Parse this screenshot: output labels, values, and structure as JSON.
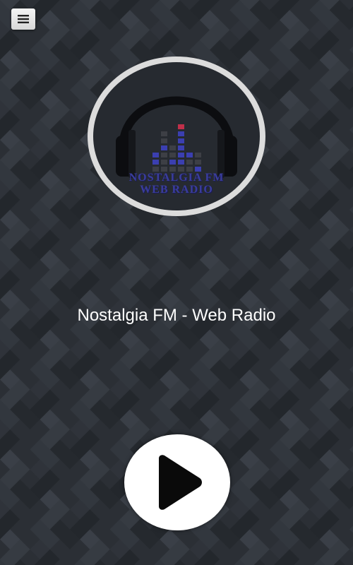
{
  "app": {
    "station_title": "Nostalgia FM - Web Radio"
  },
  "logo": {
    "line1": "NOSTALGIA FM",
    "line2": "WEB RADIO"
  },
  "toolbar": {
    "menu_icon": "hamburger-menu-icon"
  },
  "player": {
    "state": "stopped",
    "play_icon": "play-icon"
  },
  "colors": {
    "background": "#2a2e33",
    "title_text": "#ffffff",
    "logo_text": "#3a3d9c",
    "equalizer_blue": "#3b3fb0",
    "equalizer_red": "#c0304a",
    "ring": "#dcdcdc"
  }
}
